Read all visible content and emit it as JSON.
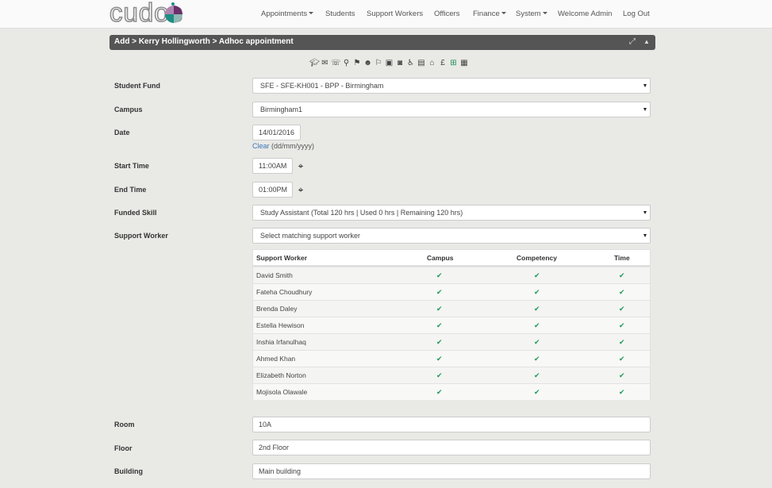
{
  "nav": {
    "logo": "cudos",
    "items": [
      {
        "label": "Appointments",
        "dropdown": true
      },
      {
        "label": "Students",
        "dropdown": false
      },
      {
        "label": "Support Workers",
        "dropdown": false
      },
      {
        "label": "Officers",
        "dropdown": false
      },
      {
        "label": "Finance",
        "dropdown": true
      },
      {
        "label": "System",
        "dropdown": true
      },
      {
        "label": "Welcome Admin",
        "dropdown": false
      },
      {
        "label": "Log Out",
        "dropdown": false
      }
    ]
  },
  "panel": {
    "breadcrumb": "Add > Kerry Hollingworth > Adhoc appointment",
    "expand_icon": "expand-icon",
    "collapse_icon": "chevron-up-icon"
  },
  "toolbar_icons": [
    "graduation-cap-icon",
    "envelope-icon",
    "phone-icon",
    "map-marker-icon",
    "pin-icon",
    "users-icon",
    "map-pin-icon",
    "id-card-icon",
    "phone-square-icon",
    "wheelchair-icon",
    "document-icon",
    "bank-icon",
    "pound-icon",
    "calendar-plus-icon",
    "calendar-icon"
  ],
  "form": {
    "student_fund": {
      "label": "Student Fund",
      "value": "SFE - SFE-KH001 - BPP - Birmingham"
    },
    "campus": {
      "label": "Campus",
      "value": "Birmingham1"
    },
    "date": {
      "label": "Date",
      "value": "14/01/2016",
      "clear": "Clear",
      "format": "(dd/mm/yyyy)"
    },
    "start_time": {
      "label": "Start Time",
      "value": "11:00AM"
    },
    "end_time": {
      "label": "End Time",
      "value": "01:00PM"
    },
    "funded_skill": {
      "label": "Funded Skill",
      "value": "Study Assistant (Total 120 hrs | Used 0 hrs | Remaining 120 hrs)"
    },
    "support_worker": {
      "label": "Support Worker",
      "placeholder": "Select matching support worker"
    },
    "room": {
      "label": "Room",
      "value": "10A"
    },
    "floor": {
      "label": "Floor",
      "value": "2nd Floor"
    },
    "building": {
      "label": "Building",
      "value": "Main building"
    }
  },
  "table": {
    "headers": {
      "worker": "Support Worker",
      "campus": "Campus",
      "competency": "Competency",
      "time": "Time"
    },
    "rows": [
      {
        "name": "David Smith",
        "campus": true,
        "competency": true,
        "time": true
      },
      {
        "name": "Fateha Choudhury",
        "campus": true,
        "competency": true,
        "time": true
      },
      {
        "name": "Brenda Daley",
        "campus": true,
        "competency": true,
        "time": true
      },
      {
        "name": "Estella Hewison",
        "campus": true,
        "competency": true,
        "time": true
      },
      {
        "name": "Inshia Irfanulhaq",
        "campus": true,
        "competency": true,
        "time": true
      },
      {
        "name": "Ahmed Khan",
        "campus": true,
        "competency": true,
        "time": true
      },
      {
        "name": "Elizabeth Norton",
        "campus": true,
        "competency": true,
        "time": true
      },
      {
        "name": "Mojisola Olawale",
        "campus": true,
        "competency": true,
        "time": true
      }
    ],
    "check_color": "#1f9a5b"
  }
}
